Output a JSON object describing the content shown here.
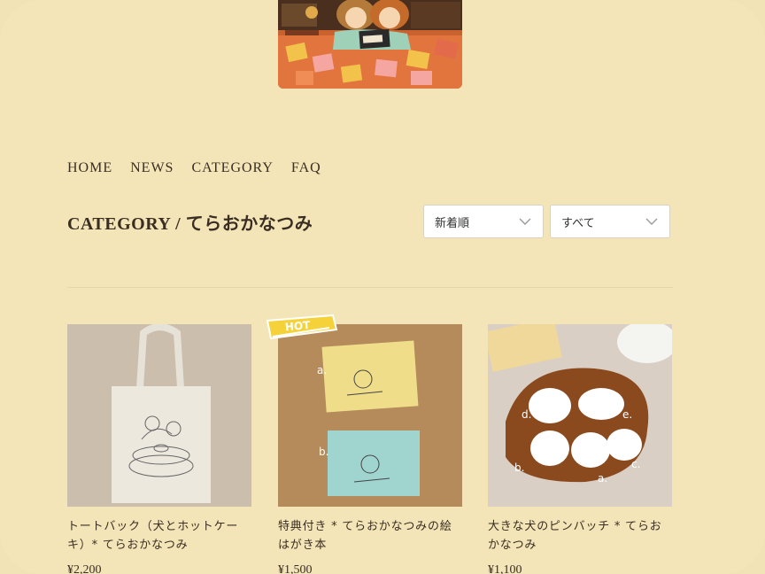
{
  "nav": {
    "home": "HOME",
    "news": "NEWS",
    "category": "CATEGORY",
    "faq": "FAQ"
  },
  "page": {
    "title": "CATEGORY / てらおかなつみ"
  },
  "filters": {
    "sort": {
      "selected": "新着順"
    },
    "category": {
      "selected": "すべて"
    }
  },
  "products": [
    {
      "name": "トートバック（犬とホットケーキ）* てらおかなつみ",
      "price": "¥2,200",
      "badge": ""
    },
    {
      "name": "特典付き * てらおかなつみの絵はがき本",
      "price": "¥1,500",
      "badge": "HOT"
    },
    {
      "name": "大きな犬のピンバッチ * てらおかなつみ",
      "price": "¥1,100",
      "badge": ""
    }
  ],
  "image_labels": {
    "p2": [
      "a.",
      "b."
    ],
    "p3": [
      "d.",
      "e.",
      "b.",
      "c.",
      "a."
    ]
  },
  "colors": {
    "background": "#f3e5b8",
    "text": "#3a2e22",
    "hot_badge": "#f5d23a"
  }
}
